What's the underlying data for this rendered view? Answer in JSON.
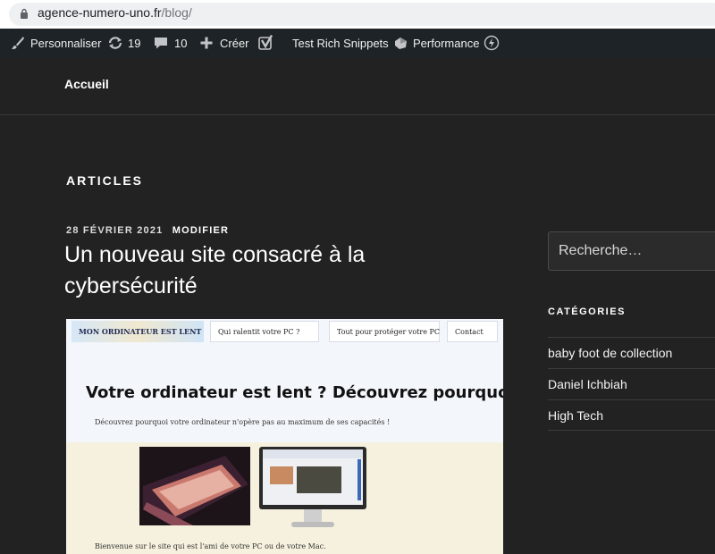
{
  "browser": {
    "url_host": "agence-numero-uno.fr",
    "url_path": "/blog/"
  },
  "admin_bar": {
    "customize_label": "Personnaliser",
    "updates_count": "19",
    "comments_count": "10",
    "new_label": "Créer",
    "rich_snippets_label": "Test Rich Snippets",
    "performance_label": "Performance",
    "icons": [
      "paintbrush-icon",
      "updates-icon",
      "comment-icon",
      "plus-icon",
      "yoast-icon",
      "performance-icon",
      "bolt-icon"
    ]
  },
  "site_nav": {
    "home_label": "Accueil"
  },
  "main": {
    "page_title": "ARTICLES",
    "post": {
      "date": "28 FÉVRIER 2021",
      "edit_label": "MODIFIER",
      "title": "Un nouveau site consacré à la cybersécurité"
    },
    "featured_image": {
      "logo_text": "MON ORDINATEUR EST LENT",
      "nav_1": "Qui ralentit votre PC ?",
      "nav_2": "Tout pour protéger votre PC",
      "nav_3": "Contact",
      "headline": "Votre ordinateur est lent ? Découvrez pourquoi…",
      "subline": "Découvrez pourquoi votre ordinateur n'opère pas au maximum de ses capacités !",
      "caption": "Bienvenue sur le site qui est l'ami de votre PC ou de votre Mac."
    }
  },
  "sidebar": {
    "search_placeholder": "Recherche…",
    "categories_title": "CATÉGORIES",
    "categories": [
      {
        "label": "baby foot de collection"
      },
      {
        "label": "Daniel Ichbiah"
      },
      {
        "label": "High Tech"
      }
    ]
  },
  "colors": {
    "page_background": "#222222",
    "admin_bar": "#1d2327",
    "text": "#ffffff"
  }
}
